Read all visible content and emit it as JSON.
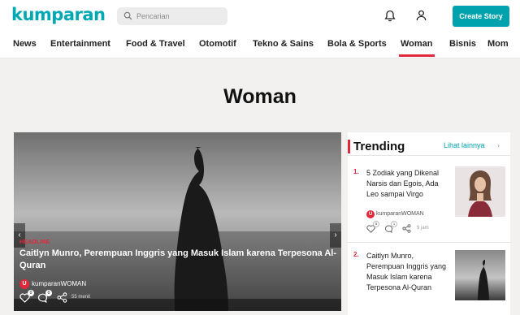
{
  "header": {
    "logo_text": "kumparan",
    "search_placeholder": "Pencarian",
    "create_label": "Create Story",
    "icons": [
      "search-icon",
      "bell-icon",
      "user-icon"
    ]
  },
  "nav": {
    "items": [
      "News",
      "Entertainment",
      "Food & Travel",
      "Otomotif",
      "Tekno & Sains",
      "Bola & Sports",
      "Woman",
      "Bisnis",
      "Mom"
    ],
    "active": "Woman"
  },
  "page": {
    "title": "Woman"
  },
  "hero": {
    "tag": "HEADLINE",
    "title": "Caitlyn Munro, Perempuan Inggris yang Masuk Islam karena Terpesona Al-Quran",
    "source_badge": "U",
    "source": "kumparanWOMAN",
    "likes": "0",
    "comments": "0",
    "time": "55 menit",
    "prev_arrow": "‹",
    "next_arrow": "›"
  },
  "trending": {
    "title": "Trending",
    "more": "Lihat lainnya",
    "more_chevron": "›",
    "items": [
      {
        "num": "1.",
        "title": "5 Zodiak yang Dikenal Narsis dan Egois, Ada Leo sampai Virgo",
        "source_badge": "U",
        "source": "kumparanWOMAN",
        "likes": "5",
        "comments": "1",
        "time": "9 jam"
      },
      {
        "num": "2.",
        "title": "Caitlyn Munro, Perempuan Inggris yang Masuk Islam karena Terpesona Al-Quran"
      }
    ]
  },
  "colors": {
    "brand": "#00a2ae",
    "accent": "#e0283a"
  }
}
